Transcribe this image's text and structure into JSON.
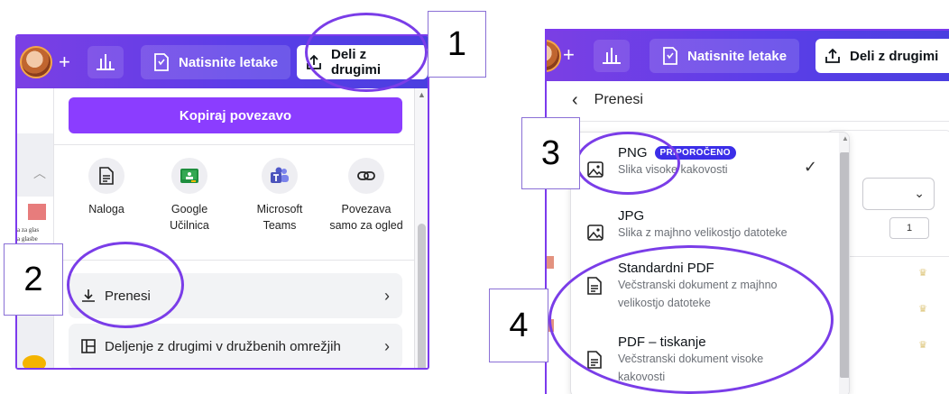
{
  "left_panel": {
    "topbar": {
      "plus": "+",
      "print_button": "Natisnite letake",
      "share_button": "Deli z drugimi"
    },
    "canvas_text": [
      "a za glas",
      "a glasbe"
    ],
    "dropdown": {
      "copy_link": "Kopiraj povezavo",
      "share_options": [
        {
          "line1": "Naloga",
          "line2": "",
          "icon": "document-icon"
        },
        {
          "line1": "Google",
          "line2": "Učilnica",
          "icon": "google-classroom-icon"
        },
        {
          "line1": "Microsoft",
          "line2": "Teams",
          "icon": "microsoft-teams-icon"
        },
        {
          "line1": "Povezava",
          "line2": "samo za ogled",
          "icon": "link-icon"
        }
      ],
      "download": {
        "label": "Prenesi",
        "chevron": "›"
      },
      "social": {
        "label": "Deljenje z drugimi v družbenih omrežjih",
        "chevron": "›"
      }
    }
  },
  "right_panel": {
    "topbar": {
      "plus": "+",
      "print_button": "Natisnite letake",
      "share_button": "Deli z drugimi"
    },
    "header": {
      "back": "‹",
      "title": "Prenesi"
    },
    "page_count": "1",
    "format_list": [
      {
        "name": "PNG",
        "badge": "PRIPOROČENO",
        "desc": "Slika visoke kakovosti",
        "selected": true
      },
      {
        "name": "JPG",
        "desc": "Slika z majhno velikostjo datoteke"
      },
      {
        "name": "Standardni PDF",
        "desc": "Večstranski dokument z majhno velikostjo datoteke"
      },
      {
        "name": "PDF – tiskanje",
        "desc": "Večstranski dokument visoke kakovosti"
      }
    ]
  },
  "callouts": [
    "1",
    "2",
    "3",
    "4"
  ],
  "colors": {
    "accent": "#8b3dff",
    "topbar": "#5b3ee8",
    "annotation": "#7a3de8",
    "badge": "#3b2ee8"
  }
}
